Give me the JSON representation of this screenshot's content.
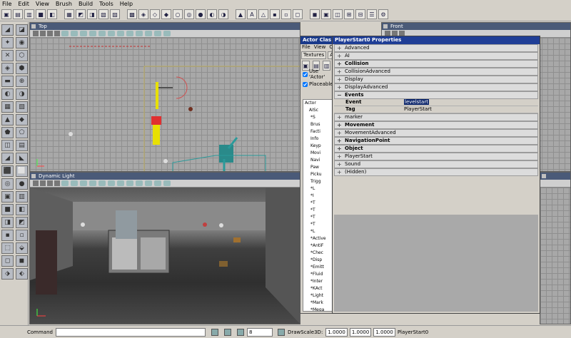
{
  "menu": [
    "File",
    "Edit",
    "View",
    "Brush",
    "Build",
    "Tools",
    "Help"
  ],
  "viewports": {
    "top": {
      "title": "Top"
    },
    "front": {
      "title": "Front"
    },
    "persp": {
      "title": "Dynamic Light"
    }
  },
  "actor_browser": {
    "title": "Actor Clas",
    "menu": [
      "File",
      "View",
      "O"
    ],
    "tabs": [
      "Textures",
      "Act"
    ],
    "use_actor_label": "Use 'Actor'",
    "placeable_label": "Placeable",
    "tree": [
      "Actor",
      "AISc",
      "*S",
      "Brus",
      "Facti",
      "Info",
      "Keyp",
      "Movi",
      "Navi",
      "Paw",
      "Picku",
      "Trigg",
      "*L",
      "*I",
      "*T",
      "*T",
      "*T",
      "*T",
      "*L",
      "*Active",
      "*AntiF",
      "*Chec",
      "*Disp",
      "*Emitt",
      "*Fluid",
      "*Inter",
      "*KAct",
      "*Light",
      "*Mark",
      "*Mega",
      "*Missi"
    ]
  },
  "properties": {
    "title": "PlayerStart0 Properties",
    "groups": [
      {
        "label": "Advanced",
        "bold": false,
        "open": false
      },
      {
        "label": "AI",
        "bold": false,
        "open": false
      },
      {
        "label": "Collision",
        "bold": true,
        "open": false
      },
      {
        "label": "CollisionAdvanced",
        "bold": false,
        "open": false
      },
      {
        "label": "Display",
        "bold": false,
        "open": false
      },
      {
        "label": "DisplayAdvanced",
        "bold": false,
        "open": false
      },
      {
        "label": "Events",
        "bold": true,
        "open": true
      }
    ],
    "events": [
      {
        "key": "Event",
        "value": "levelstart",
        "selected": true
      },
      {
        "key": "Tag",
        "value": "PlayerStart",
        "selected": false
      }
    ],
    "groups_after": [
      {
        "label": "marker",
        "bold": false
      },
      {
        "label": "Movement",
        "bold": true
      },
      {
        "label": "MovementAdvanced",
        "bold": false
      },
      {
        "label": "NavigationPoint",
        "bold": true
      },
      {
        "label": "Object",
        "bold": true
      },
      {
        "label": "PlayerStart",
        "bold": false
      },
      {
        "label": "Sound",
        "bold": false
      },
      {
        "label": "(Hidden)",
        "bold": false
      }
    ]
  },
  "status": {
    "command_label": "Command",
    "grid_value": "8",
    "drawscale_label": "DrawScale3D:",
    "scale_x": "1.0000",
    "scale_y": "1.0000",
    "scale_z": "1.0000",
    "selection": "PlayerStart0"
  }
}
